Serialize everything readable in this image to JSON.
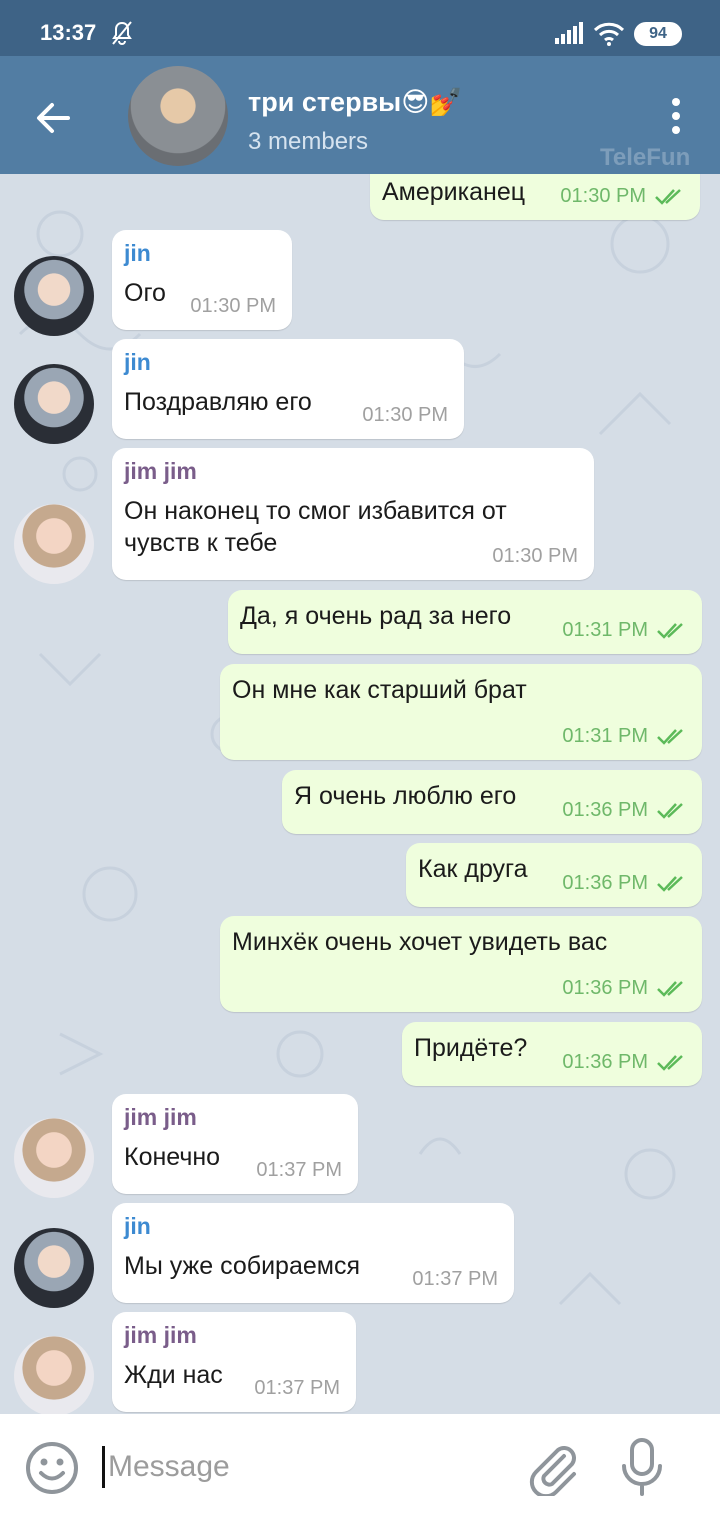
{
  "status_bar": {
    "time": "13:37",
    "battery": "94"
  },
  "header": {
    "title": "три стервы😎💅",
    "subtitle": "3 members",
    "watermark": "TeleFun"
  },
  "colors": {
    "header": "#527da3",
    "status_bar": "#3e6386",
    "outgoing_bubble": "#effedd",
    "jin": "#3d8ad1",
    "jim_jim": "#7a5d8a"
  },
  "messages": [
    {
      "dir": "out",
      "text": "Американец",
      "time": "01:30 PM",
      "read": true
    },
    {
      "dir": "in",
      "sender": "jin",
      "text": "Ого",
      "time": "01:30 PM"
    },
    {
      "dir": "in",
      "sender": "jin",
      "text": "Поздравляю его",
      "time": "01:30 PM"
    },
    {
      "dir": "in",
      "sender": "jim jim",
      "text": "Он наконец то смог избавится от чувств к тебе",
      "time": "01:30 PM"
    },
    {
      "dir": "out",
      "text": "Да, я очень рад за него",
      "time": "01:31 PM",
      "read": true
    },
    {
      "dir": "out",
      "text": "Он мне как старший брат",
      "time": "01:31 PM",
      "read": true
    },
    {
      "dir": "out",
      "text": "Я очень люблю его",
      "time": "01:36 PM",
      "read": true
    },
    {
      "dir": "out",
      "text": "Как друга",
      "time": "01:36 PM",
      "read": true
    },
    {
      "dir": "out",
      "text": "Минхёк очень хочет увидеть вас",
      "time": "01:36 PM",
      "read": true
    },
    {
      "dir": "out",
      "text": "Придёте?",
      "time": "01:36 PM",
      "read": true
    },
    {
      "dir": "in",
      "sender": "jim jim",
      "text": "Конечно",
      "time": "01:37 PM"
    },
    {
      "dir": "in",
      "sender": "jin",
      "text": "Мы уже собираемся",
      "time": "01:37 PM"
    },
    {
      "dir": "in",
      "sender": "jim jim",
      "text": "Жди нас",
      "time": "01:37 PM"
    }
  ],
  "composer": {
    "placeholder": "Message"
  },
  "icons": {
    "back": "arrow-left-icon",
    "menu": "more-vertical-icon",
    "emoji": "emoji-icon",
    "attach": "paperclip-icon",
    "mic": "microphone-icon"
  }
}
